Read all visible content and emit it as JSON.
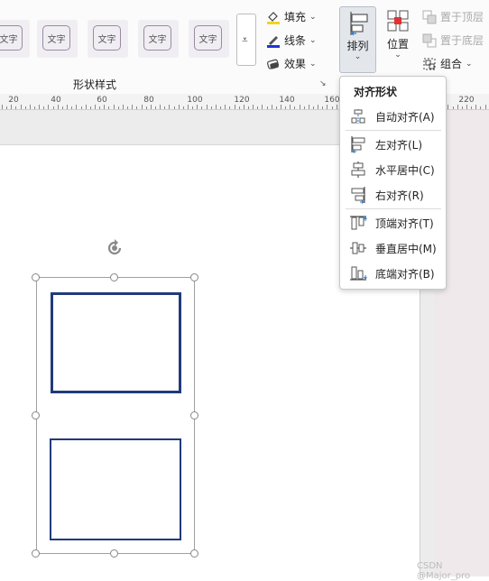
{
  "style_gallery": {
    "tile_text": "文字"
  },
  "ribbon": {
    "fill_label": "填充",
    "line_label": "线条",
    "effects_label": "效果",
    "group_label": "形状样式",
    "arrange_label": "排列",
    "position_label": "位置",
    "bring_forward_label": "置于顶层",
    "send_backward_label": "置于底层",
    "group_btn_label": "组合"
  },
  "ruler": {
    "labels": [
      "20",
      "40",
      "60",
      "80",
      "100",
      "120",
      "140",
      "160",
      "220"
    ]
  },
  "align_menu": {
    "title": "对齐形状",
    "items": [
      {
        "label": "自动对齐(A)",
        "icon": "auto-align-icon"
      },
      {
        "label": "左对齐(L)",
        "icon": "align-left-icon"
      },
      {
        "label": "水平居中(C)",
        "icon": "align-center-icon"
      },
      {
        "label": "右对齐(R)",
        "icon": "align-right-icon"
      },
      {
        "label": "顶端对齐(T)",
        "icon": "align-top-icon"
      },
      {
        "label": "垂直居中(M)",
        "icon": "align-middle-icon"
      },
      {
        "label": "底端对齐(B)",
        "icon": "align-bottom-icon"
      }
    ]
  },
  "watermark": "CSDN @Major_pro",
  "colors": {
    "shape_border": "#213a7a",
    "arrange_active_bg": "#e3e7ec",
    "fill_icon": "#f5d31b",
    "line_icon": "#1d34d8"
  }
}
